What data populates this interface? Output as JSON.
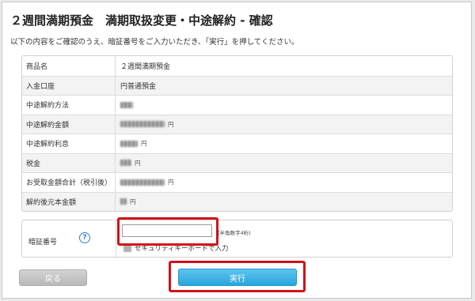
{
  "page": {
    "title": "２週間満期預金　満期取扱変更・中途解約 - 確認",
    "instruction": "以下の内容をご確認のうえ、暗証番号をご入力いただき、「実行」を押してください。"
  },
  "details": {
    "rows": [
      {
        "label": "商品名",
        "value": "２週間満期預金"
      },
      {
        "label": "入金口座",
        "value": "円普通預金"
      },
      {
        "label": "中途解約方法",
        "value": ""
      },
      {
        "label": "中途解約金額",
        "value": "",
        "unit": "円"
      },
      {
        "label": "中途解約利息",
        "value": "",
        "unit": "円"
      },
      {
        "label": "税金",
        "value": "",
        "unit": "円"
      },
      {
        "label": "お受取金額合計（税引後）",
        "value": "",
        "unit": "円"
      },
      {
        "label": "解約後元本金額",
        "value": "",
        "unit": "円"
      }
    ]
  },
  "pin": {
    "label": "暗証番号",
    "help_icon": "question-circle-icon",
    "value": "",
    "note": "(半角数字4桁)",
    "keyboard_label": "セキュリティキーボードで入力"
  },
  "buttons": {
    "back_label": "戻る",
    "execute_label": "実行"
  },
  "colors": {
    "highlight": "#d0121a",
    "execute": "#2aa5de",
    "help": "#2a7fd0"
  }
}
